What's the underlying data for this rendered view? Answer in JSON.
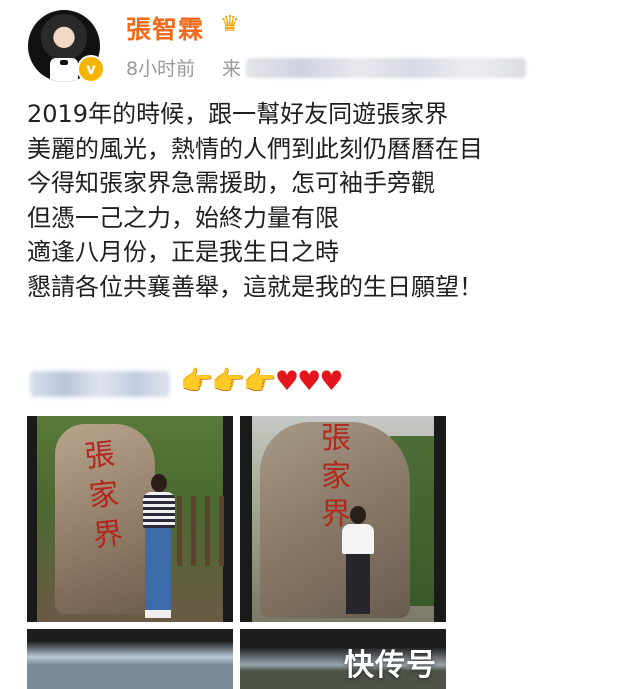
{
  "header": {
    "username": "張智霖",
    "crown_icon": "crown-icon",
    "time": "8小时前",
    "source_label": "来"
  },
  "post": {
    "lines": [
      "2019年的時候，跟一幫好友同遊張家界",
      "美麗的風光，熱情的人們到此刻仍曆曆在目",
      "今得知張家界急需援助，怎可袖手旁觀",
      "但憑一己之力，始終力量有限",
      "適逢八月份，正是我生日之時",
      "懇請各位共襄善舉，這就是我的生日願望！"
    ],
    "emoji": {
      "hand": "👉",
      "heart": "♥"
    }
  },
  "photos": {
    "p1_inscription": "張家界",
    "p2_inscription": "張家界"
  },
  "watermark": "快传号",
  "colors": {
    "username": "#f26a1b",
    "verified": "#f6b400",
    "heart": "#e3161e",
    "hand": "#f5b800"
  }
}
